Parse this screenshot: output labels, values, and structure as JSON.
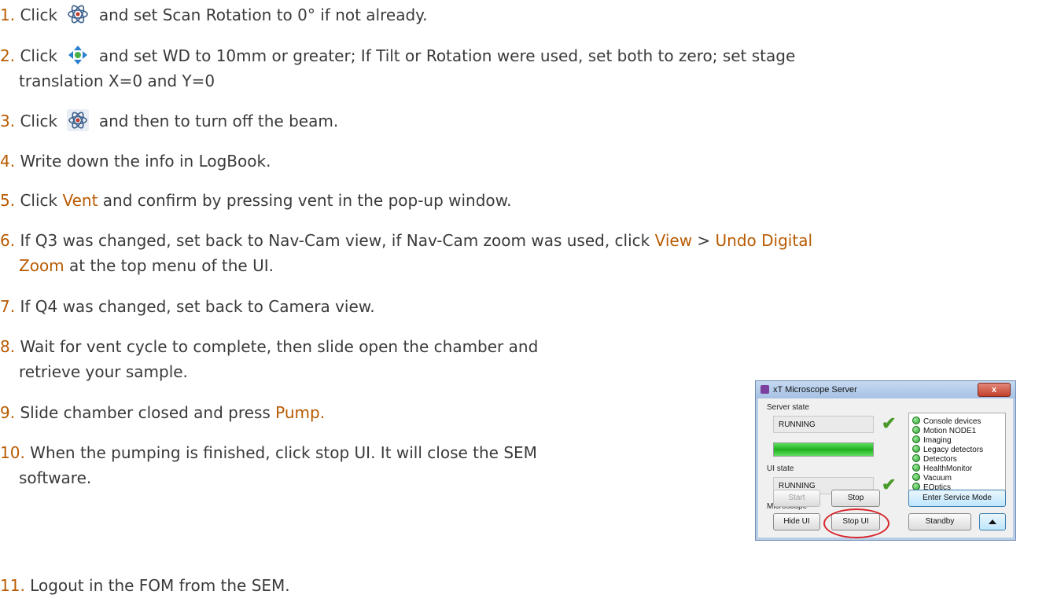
{
  "steps": [
    {
      "num": "1.",
      "pre": "Click",
      "post": "and set Scan Rotation to 0° if not already.",
      "icon": "atom-beam-icon"
    },
    {
      "num": "2.",
      "pre": "Click",
      "post": "and set WD to 10mm or greater; If Tilt or Rotation were used, set both to zero; set stage",
      "cont": "translation X=0 and Y=0",
      "icon": "stage-arrows-icon"
    },
    {
      "num": "3.",
      "pre": "Click",
      "post": "and then to turn off the beam.",
      "icon": "atom-beam-icon"
    },
    {
      "num": "4.",
      "text": "Write down the info in LogBook."
    },
    {
      "num": "5.",
      "pre": "Click",
      "hl": "Vent",
      "post": "and confirm by pressing vent in the pop-up window."
    },
    {
      "num": "6.",
      "pre": "If Q3 was changed, set back to Nav-Cam view, if Nav-Cam zoom was used, click",
      "hl1": "View",
      "mid": ">",
      "hl2": "Undo Digital",
      "cont_hl": "Zoom",
      "cont_rest": "at the top menu of the UI."
    },
    {
      "num": "7.",
      "text": "If Q4 was changed, set back to Camera view."
    },
    {
      "num": "8.",
      "text": "Wait for vent cycle to complete, then slide open the chamber and",
      "cont": "retrieve your sample."
    },
    {
      "num": "9.",
      "pre": "Slide chamber closed and press",
      "hl": "Pump."
    },
    {
      "num": "10.",
      "text": "When the pumping is finished, click stop UI. It will close the SEM",
      "cont": "software."
    },
    {
      "num": "11.",
      "text": "Logout in the FOM from the SEM."
    }
  ],
  "dialog": {
    "title": "xT Microscope Server",
    "close": "x",
    "server_state_label": "Server state",
    "server_state_value": "RUNNING",
    "ui_state_label": "UI state",
    "ui_state_value": "RUNNING",
    "progress": 1.0,
    "modules": [
      "Console devices",
      "Motion NODE1",
      "Imaging",
      "Legacy detectors",
      "Detectors",
      "HealthMonitor",
      "Vacuum",
      "EOptics"
    ],
    "microscope_label": "Microscope",
    "buttons": {
      "start": "Start",
      "stop": "Stop",
      "enter_service": "Enter Service Mode",
      "hide_ui": "Hide UI",
      "stop_ui": "Stop UI",
      "standby": "Standby"
    }
  },
  "colors": {
    "highlight": "#b85a00",
    "ok_green": "#4a9a2a",
    "annotation_red": "#d8262c"
  }
}
